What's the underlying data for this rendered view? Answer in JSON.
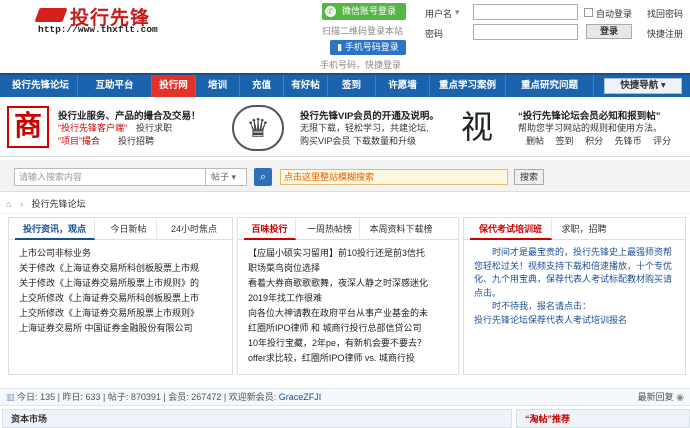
{
  "logo": {
    "title": "投行先锋",
    "url": "http://www.thxflt.com"
  },
  "login_social": {
    "wechat_button": "微信账号登录",
    "qr_hint": "扫描二维码登录本站",
    "phone_button": "手机号码登录",
    "phone_hint": "手机号码，快捷登录"
  },
  "login": {
    "username_label": "用户名",
    "password_label": "密码",
    "auto_login": "自动登录",
    "forgot": "找回密码",
    "submit": "登录",
    "register": "快捷注册"
  },
  "nav": {
    "items": [
      "投行先锋论坛",
      "互助平台",
      "投行网",
      "培训",
      "充值",
      "有好帖",
      "签到",
      "许愿墙",
      "重点学习案例",
      "重点研究问题"
    ],
    "quick": "快捷导航 ▾"
  },
  "promo": {
    "box1": {
      "badge": "商",
      "title": "投行业服务、产品的撮合及交易！",
      "l1a": "“投行先锋客户端”",
      "l1b": "投行求职",
      "l2a": "“项目”撮合",
      "l2b": "投行招聘"
    },
    "box2": {
      "badge": "♛",
      "title": "投行先锋VIP会员的开通及说明。",
      "l1": "无限下载，轻松学习，共建论坛,",
      "l2": "购买VIP会员   下载数量和升级"
    },
    "box3": {
      "badge": "视",
      "title": "“投行先锋论坛会员必知和报到帖”",
      "l1": "帮助您学习网站的规则和使用方法。",
      "l2": [
        "删帖",
        "签到",
        "积分",
        "先锋币",
        "评分"
      ]
    }
  },
  "search": {
    "placeholder": "请输入搜索内容",
    "type": "帖子 ▾",
    "go_icon": "search-icon",
    "hot": "点击这里整站模糊搜索",
    "button": "搜索"
  },
  "breadcrumb": {
    "home_icon": "home-icon",
    "sep": "›",
    "current": "投行先锋论坛"
  },
  "col1": {
    "tabs": [
      "投行资讯，观点",
      "今日新帖",
      "24小时焦点"
    ],
    "items": [
      "上市公司非标业务",
      "关于修改《上海证券交易所科创板股票上市规",
      "关于修改《上海证券交易所股票上市规则》的",
      "上交所修改《上海证券交易所科创板股票上市",
      "上交所修改《上海证券交易所股票上市规则》",
      "上海证券交易所 中国证券金融股份有限公司"
    ]
  },
  "col2": {
    "tabs": [
      "百味投行",
      "一周热帖榜",
      "本周资料下载榜"
    ],
    "items": [
      "【应届小硕实习留用】前10投行还是前3信托",
      "职场菜鸟岗位选择",
      "看着大券商歌歌歌舞，夜深人静之时深感迷化",
      "2019年找工作很难",
      "向各位大神请教在政府平台从事产业基金的未",
      "红圈所IPO律师 和 城商行投行总部信贷公司",
      "10年投行宝藏，2年pe，有新机会要不要去？",
      "offer求比较，红圈所IPO律师 vs. 城商行投"
    ]
  },
  "col3": {
    "tabs": [
      "保代考试培训班",
      "求职，招聘"
    ],
    "p1": "　　时间才是最宝贵的，投行先锋史上最强师资帮您轻松过关！视频支持下载和倍速播放，十个专优化、九个用宝典，保荐代表人考试标配教材购买请点击。",
    "p2": "　　时不待我，报名请点击：",
    "p3": "投行先锋论坛保荐代表人考试培训报名"
  },
  "stats": {
    "today_label": "今日:",
    "today": "135",
    "yesterday_label": "昨日:",
    "yesterday": "633",
    "posts_label": "帖子:",
    "posts": "870391",
    "members_label": "会员:",
    "members": "267472",
    "welcome": "欢迎新会员:",
    "newest": "GraceZFJI",
    "latest": "最新回复"
  },
  "bottom": {
    "left": "资本市场",
    "right": "“淘帖”推荐"
  }
}
